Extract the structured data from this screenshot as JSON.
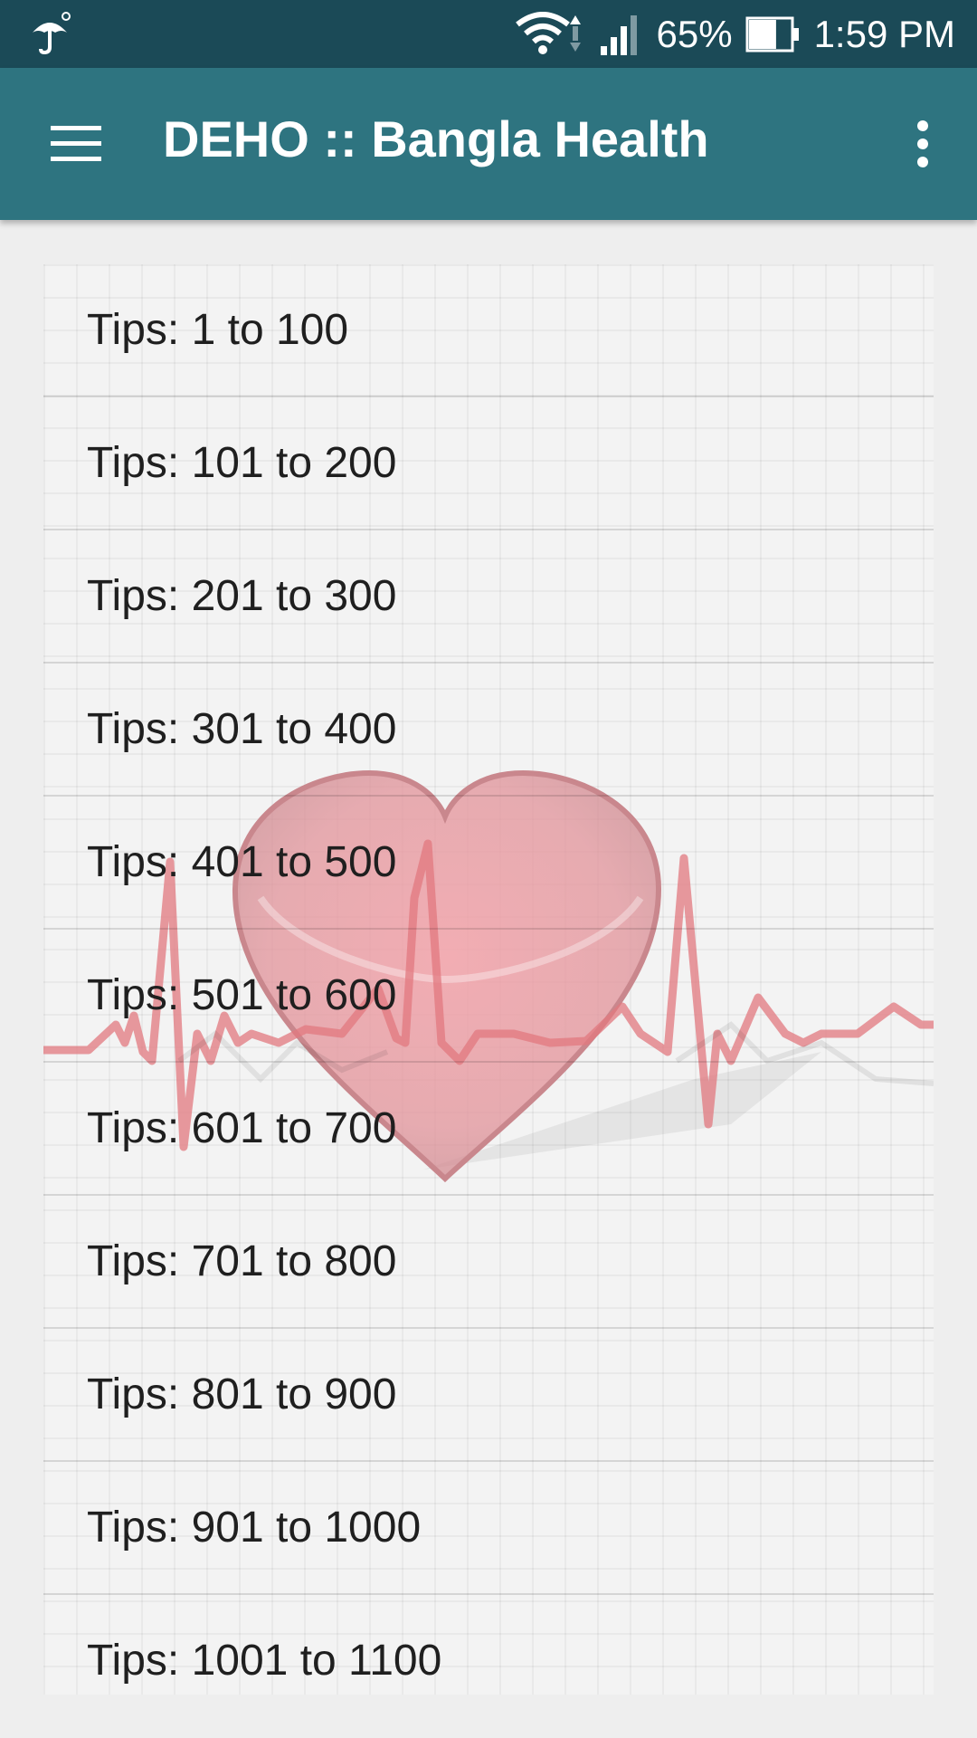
{
  "status_bar": {
    "notification_icon": "umbrella-icon",
    "wifi_icon": "wifi-icon",
    "signal_icon": "signal-icon",
    "battery_percent": "65%",
    "battery_icon": "battery-icon",
    "battery_level": 0.65,
    "time": "1:59 PM"
  },
  "app_bar": {
    "menu_icon": "hamburger-menu-icon",
    "title": "DEHO :: Bangla Health",
    "overflow_icon": "more-vertical-icon",
    "color": "#2e7480"
  },
  "list": {
    "items": [
      {
        "label": "Tips: 1 to 100"
      },
      {
        "label": "Tips: 101 to 200"
      },
      {
        "label": "Tips: 201 to 300"
      },
      {
        "label": "Tips: 301 to 400"
      },
      {
        "label": "Tips: 401 to 500"
      },
      {
        "label": "Tips: 501 to 600"
      },
      {
        "label": "Tips: 601 to 700"
      },
      {
        "label": "Tips: 701 to 800"
      },
      {
        "label": "Tips: 801 to 900"
      },
      {
        "label": "Tips: 901 to 1000"
      },
      {
        "label": "Tips: 1001 to 1100"
      }
    ]
  },
  "colors": {
    "status_bar": "#1b4a57",
    "app_bar": "#2e7480",
    "heart": "#e88a92",
    "ecg_line": "#e2787f"
  }
}
